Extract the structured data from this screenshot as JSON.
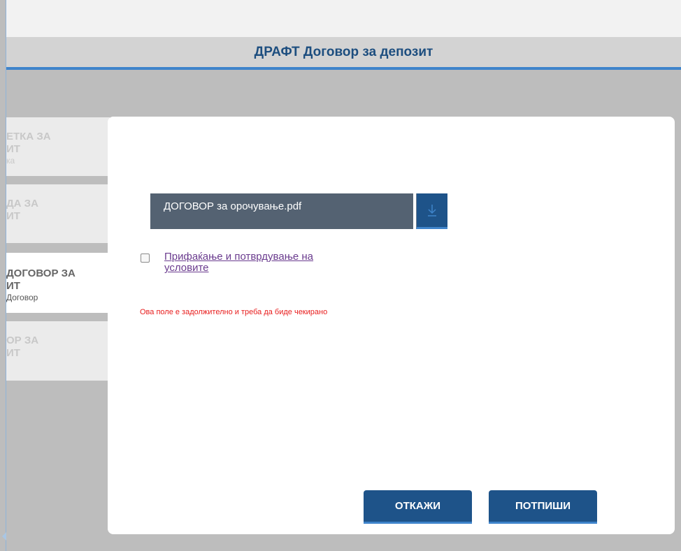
{
  "header": {
    "title": "ДРАФТ Договор за депозит"
  },
  "steps": [
    {
      "label_line1": "ЕТКА ЗА",
      "label_line2": "ИТ",
      "sub": "ка"
    },
    {
      "label_line1": "ДА ЗА",
      "label_line2": "ИТ",
      "sub": ""
    },
    {
      "label_line1": "ДОГОВОР ЗА",
      "label_line2": "ИТ",
      "sub": "Договор"
    },
    {
      "label_line1": "ОР ЗА",
      "label_line2": "ИТ",
      "sub": ""
    }
  ],
  "modal": {
    "file_name": "ДОГОВОР за орочување.pdf",
    "download_icon": "download-arrow-icon",
    "terms_checked": false,
    "terms_link": "Прифаќање и потврдување на условите",
    "error_message": "Ова поле е задолжително и треба да биде чекирано",
    "cancel_label": "ОТКАЖИ",
    "sign_label": "ПОТПИШИ"
  },
  "colors": {
    "primary": "#1e5389",
    "accent": "#3f84cb",
    "error": "#e81c1c",
    "link": "#6a3b8e"
  }
}
